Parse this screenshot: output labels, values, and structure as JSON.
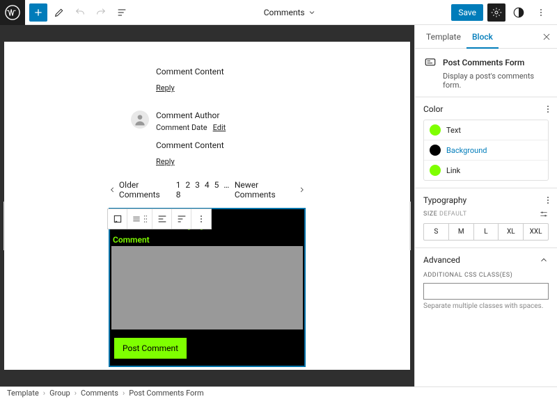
{
  "topbar": {
    "doc_title": "Comments",
    "save_label": "Save"
  },
  "canvas": {
    "comment1": {
      "content": "Comment Content",
      "reply": "Reply"
    },
    "comment2": {
      "author": "Comment Author",
      "date": "Comment Date",
      "edit": "Edit",
      "content": "Comment Content",
      "reply": "Reply"
    },
    "pagination": {
      "older": "Older Comments",
      "pages": "1 2 3 4 5 … 8",
      "newer": "Newer Comments"
    },
    "reply_form": {
      "heading": "Leave a Reply",
      "label": "Comment",
      "submit": "Post Comment"
    }
  },
  "sidebar": {
    "tabs": {
      "template": "Template",
      "block": "Block"
    },
    "block_name": "Post Comments Form",
    "block_desc": "Display a post's comments form.",
    "color": {
      "title": "Color",
      "items": [
        {
          "label": "Text",
          "hex": "#7fff00"
        },
        {
          "label": "Background",
          "hex": "#000000"
        },
        {
          "label": "Link",
          "hex": "#7fff00"
        }
      ]
    },
    "typography": {
      "title": "Typography",
      "size_label": "SIZE",
      "default": "DEFAULT",
      "sizes": [
        "S",
        "M",
        "L",
        "XL",
        "XXL"
      ]
    },
    "advanced": {
      "title": "Advanced",
      "css_label": "ADDITIONAL CSS CLASS(ES)",
      "hint": "Separate multiple classes with spaces."
    }
  },
  "breadcrumb": [
    "Template",
    "Group",
    "Comments",
    "Post Comments Form"
  ]
}
